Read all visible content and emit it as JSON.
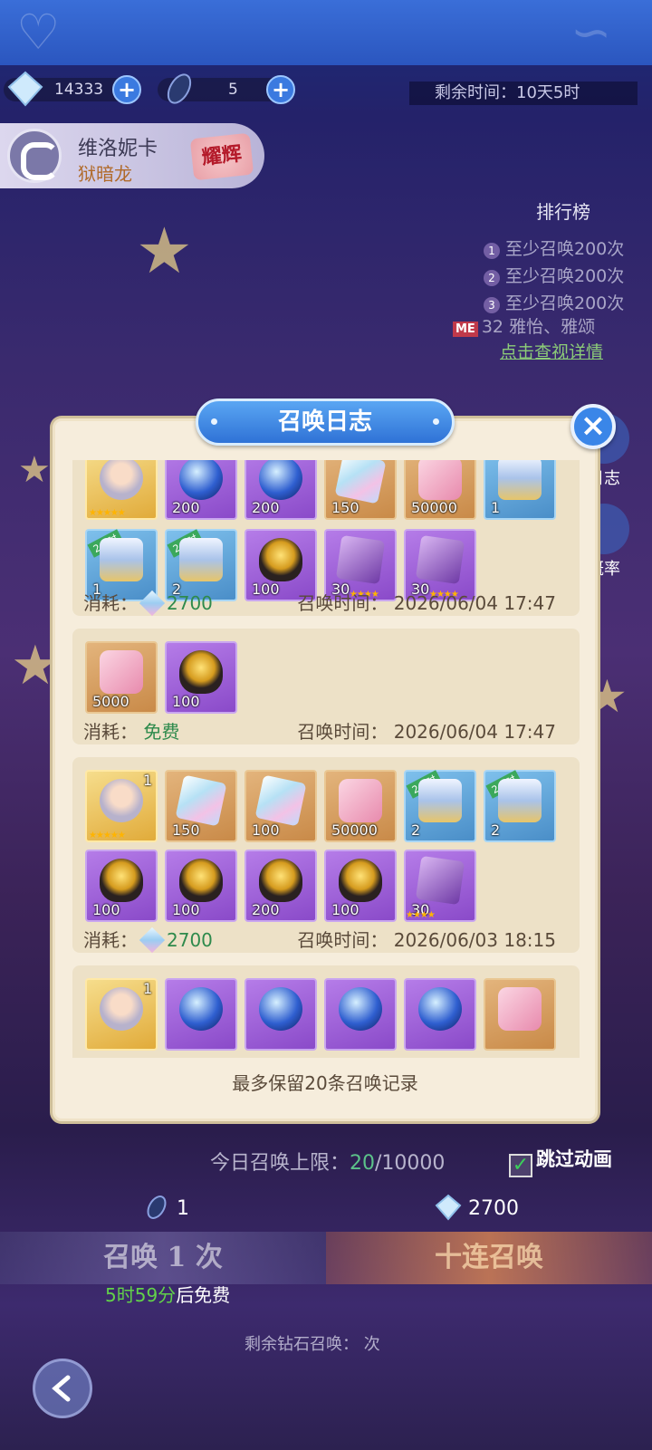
{
  "resources": {
    "gems": "14333",
    "tickets": "5",
    "timer_label": "剩余时间：",
    "timer_value": "10天5时"
  },
  "hero": {
    "name": "维洛妮卡",
    "subtitle": "狱暗龙",
    "tag": "耀辉"
  },
  "ranking": {
    "title": "排行榜",
    "rows": [
      "至少召唤200次",
      "至少召唤200次",
      "至少召唤200次"
    ],
    "me_badge": "ME",
    "me_rank": "32",
    "me_names": "雅怡、雅颂",
    "link": "点击查视详情"
  },
  "side": {
    "log": "日志",
    "prob": "概率"
  },
  "modal": {
    "title": "召唤日志",
    "footer": "最多保留20条召唤记录",
    "cost_label": "消耗：",
    "time_label": "召唤时间：",
    "records": [
      {
        "items": [
          {
            "type": "hero",
            "qty": "",
            "icon": "hero-portrait"
          },
          {
            "type": "purple",
            "qty": "200",
            "icon": "orb"
          },
          {
            "type": "purple",
            "qty": "200",
            "icon": "orb"
          },
          {
            "type": "gold",
            "qty": "150",
            "icon": "crystal"
          },
          {
            "type": "gold",
            "qty": "50000",
            "icon": "exp-heart"
          },
          {
            "type": "blue",
            "qty": "1",
            "icon": "chest"
          },
          {
            "type": "blue",
            "qty": "1",
            "icon": "chest",
            "tag": "2小时"
          },
          {
            "type": "blue",
            "qty": "2",
            "icon": "chest",
            "tag": "2小时"
          },
          {
            "type": "purple",
            "qty": "100",
            "icon": "egg"
          },
          {
            "type": "purple",
            "qty": "30",
            "icon": "shard"
          },
          {
            "type": "purple",
            "qty": "30",
            "icon": "shard"
          }
        ],
        "cost": "2700",
        "time": "2026/06/04 17:47"
      },
      {
        "items": [
          {
            "type": "gold",
            "qty": "5000",
            "icon": "exp-heart"
          },
          {
            "type": "purple",
            "qty": "100",
            "icon": "egg"
          }
        ],
        "cost": "免费",
        "time": "2026/06/04 17:47"
      },
      {
        "items": [
          {
            "type": "hero",
            "qty": "1",
            "icon": "hero-portrait"
          },
          {
            "type": "gold",
            "qty": "150",
            "icon": "crystal"
          },
          {
            "type": "gold",
            "qty": "100",
            "icon": "crystal"
          },
          {
            "type": "gold",
            "qty": "50000",
            "icon": "exp-heart"
          },
          {
            "type": "blue",
            "qty": "2",
            "icon": "chest",
            "tag": "2小时"
          },
          {
            "type": "blue",
            "qty": "2",
            "icon": "chest",
            "tag": "2小时"
          },
          {
            "type": "purple",
            "qty": "100",
            "icon": "egg"
          },
          {
            "type": "purple",
            "qty": "100",
            "icon": "egg"
          },
          {
            "type": "purple",
            "qty": "200",
            "icon": "egg"
          },
          {
            "type": "purple",
            "qty": "100",
            "icon": "egg"
          },
          {
            "type": "purple",
            "qty": "30",
            "icon": "shard"
          }
        ],
        "cost": "2700",
        "time": "2026/06/03 18:15"
      },
      {
        "items": [
          {
            "type": "hero",
            "qty": "1",
            "icon": "hero-portrait"
          },
          {
            "type": "purple",
            "qty": "",
            "icon": "orb"
          },
          {
            "type": "purple",
            "qty": "",
            "icon": "orb"
          },
          {
            "type": "purple",
            "qty": "",
            "icon": "orb"
          },
          {
            "type": "purple",
            "qty": "",
            "icon": "orb"
          },
          {
            "type": "gold",
            "qty": "",
            "icon": "exp-heart"
          }
        ]
      }
    ]
  },
  "bottom": {
    "daily_label": "今日召唤上限：",
    "daily_used": "20",
    "daily_max": "/10000",
    "skip_label": "跳过动画",
    "cost_single": "1",
    "cost_ten": "2700",
    "btn_single": "召唤 1 次",
    "btn_ten": "十连召唤",
    "free_time": "5时59分",
    "free_suffix": "后免费",
    "remain_label": "剩余钻石召唤：",
    "remain_suffix": "次"
  },
  "colors": {
    "modal_bg": "#f6eddc",
    "title_blue": "#2f72d6",
    "cost_green": "#2e8a4c"
  }
}
